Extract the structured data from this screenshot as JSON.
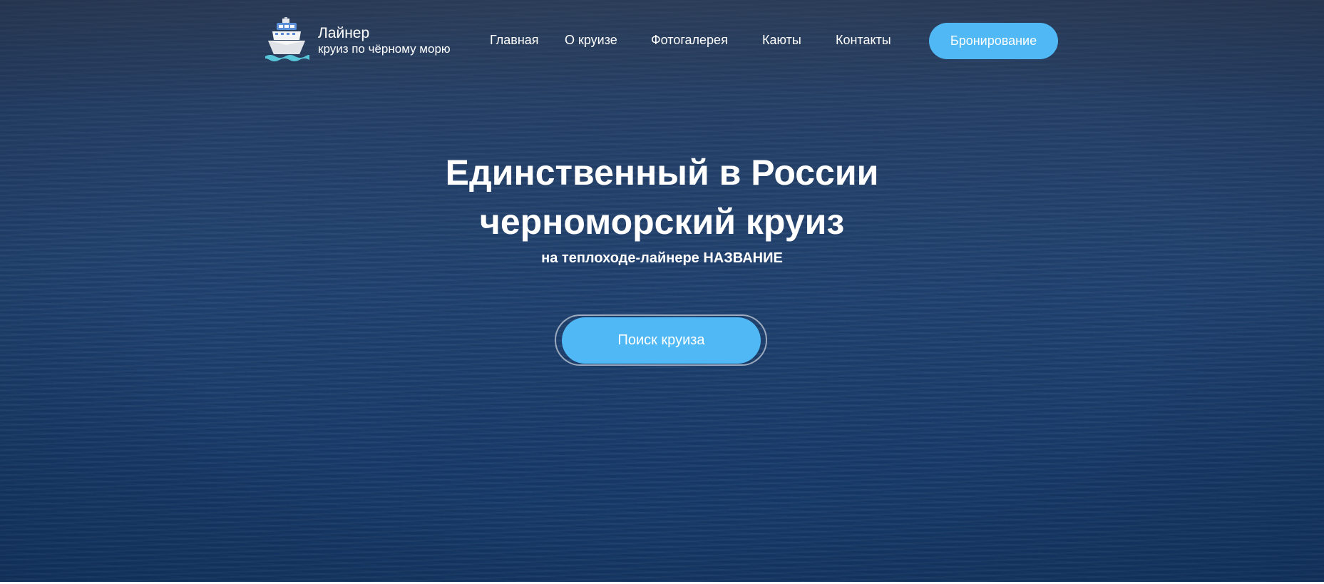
{
  "header": {
    "logo_title": "Лайнер",
    "logo_subtitle": "круиз по чёрному морю",
    "nav": [
      {
        "label": "Главная"
      },
      {
        "label": "О круизе"
      },
      {
        "label": "Фотогалерея"
      },
      {
        "label": "Каюты"
      },
      {
        "label": "Контакты"
      }
    ],
    "book_button": "Бронирование"
  },
  "hero": {
    "title_line1": "Единственный в России",
    "title_line2": "черноморский круиз",
    "subtitle": "на теплоходе-лайнере НАЗВАНИЕ",
    "search_button": "Поиск круиза"
  },
  "colors": {
    "accent": "#4fb8f5",
    "sea": "#1f416f",
    "text": "#ffffff"
  },
  "icons": {
    "logo": "cruise-ship-icon"
  }
}
